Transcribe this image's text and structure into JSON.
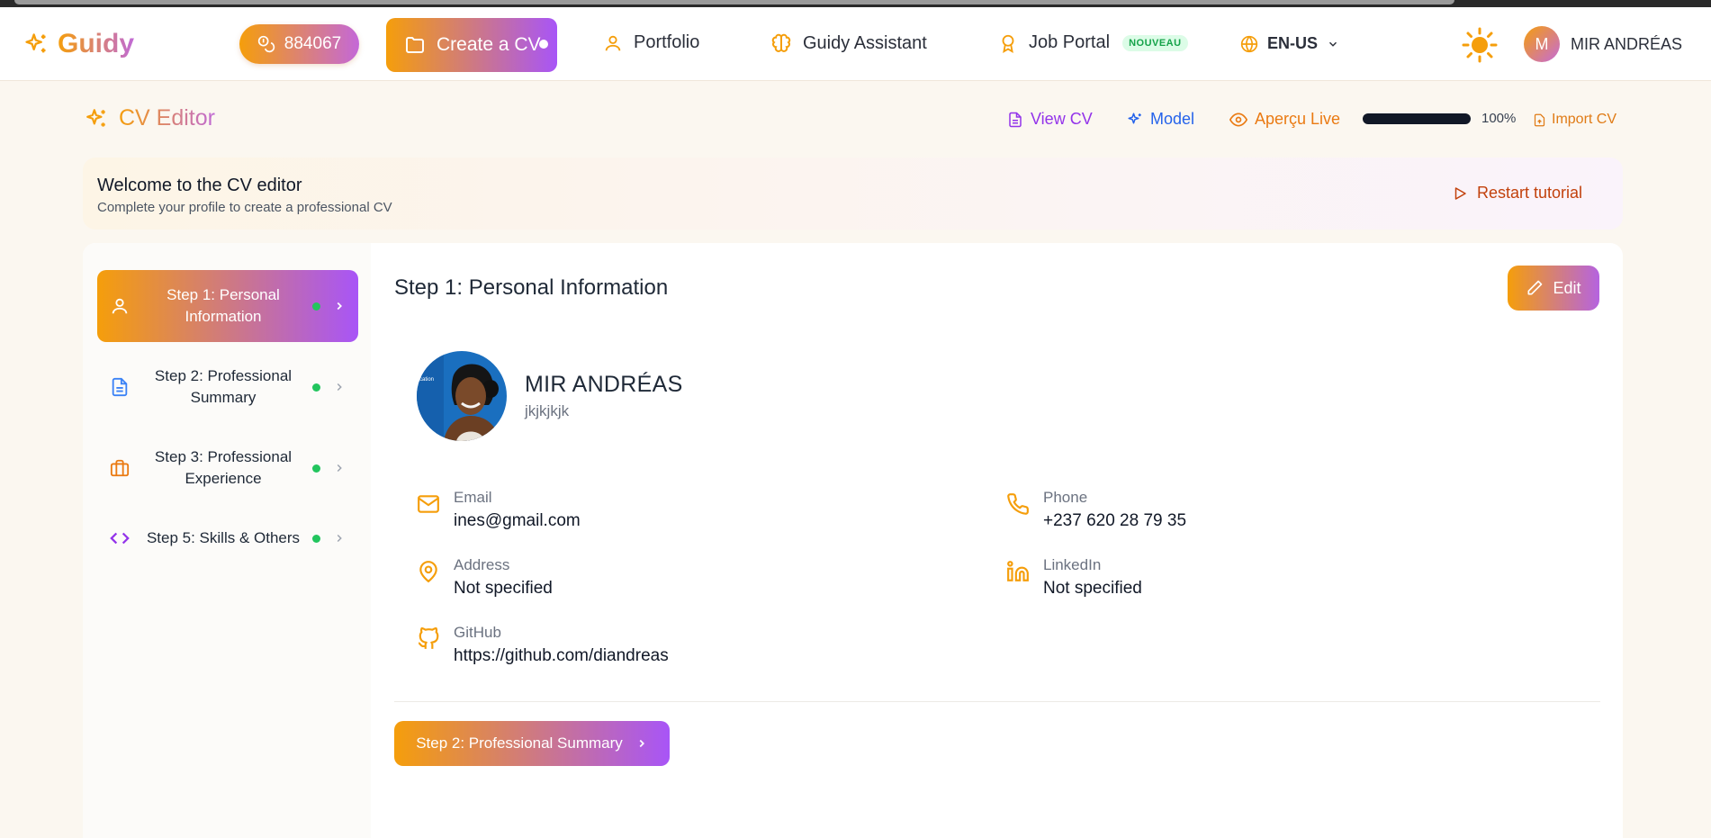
{
  "brand": {
    "name": "Guidy"
  },
  "nav": {
    "points": "884067",
    "create_cv": "Create a CV",
    "portfolio": "Portfolio",
    "assistant": "Guidy Assistant",
    "job_portal": "Job Portal",
    "job_portal_badge": "NOUVEAU",
    "language": "EN-US",
    "user_initial": "M",
    "user_name": "MIR ANDRÉAS"
  },
  "header": {
    "title": "CV Editor",
    "view_cv": "View CV",
    "model": "Model",
    "live_preview": "Aperçu Live",
    "progress": 100,
    "progress_label": "100%",
    "import_cv": "Import CV"
  },
  "welcome": {
    "heading": "Welcome to the CV editor",
    "subtitle": "Complete your profile to create a professional CV",
    "restart": "Restart tutorial"
  },
  "steps": [
    {
      "label": "Step 1: Personal Information",
      "icon": "user-icon",
      "active": true
    },
    {
      "label": "Step 2: Professional Summary",
      "icon": "document-icon",
      "active": false
    },
    {
      "label": "Step 3: Professional Experience",
      "icon": "briefcase-icon",
      "active": false
    },
    {
      "label": "Step 5: Skills & Others",
      "icon": "code-icon",
      "active": false
    }
  ],
  "content": {
    "title": "Step 1: Personal Information",
    "edit": "Edit",
    "photo_text": "cation",
    "name": "MIR ANDRÉAS",
    "subtitle": "jkjkjkjk",
    "fields": {
      "email": {
        "label": "Email",
        "value": "ines@gmail.com"
      },
      "phone": {
        "label": "Phone",
        "value": "+237 620 28 79 35"
      },
      "address": {
        "label": "Address",
        "value": "Not specified"
      },
      "linkedin": {
        "label": "LinkedIn",
        "value": "Not specified"
      },
      "github": {
        "label": "GitHub",
        "value": "https://github.com/diandreas"
      }
    },
    "next_button": "Step 2: Professional Summary"
  },
  "colors": {
    "accent_orange": "#f59e0b",
    "accent_purple": "#a855f7",
    "status_green": "#22c55e",
    "link_blue": "#2563eb"
  }
}
